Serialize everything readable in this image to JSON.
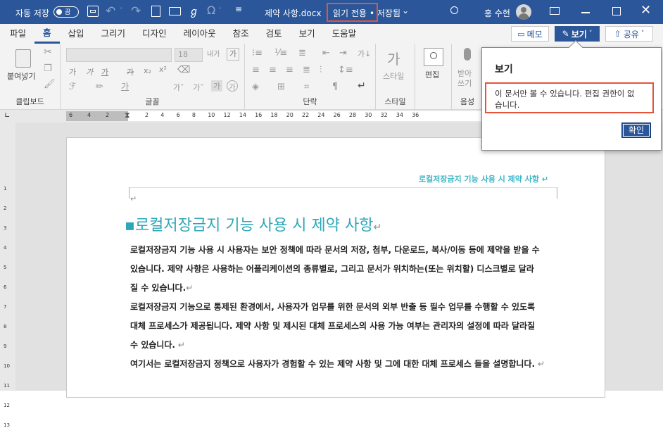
{
  "titlebar": {
    "autosave_label": "자동 저장",
    "autosave_state": "끔",
    "filename": "제약 사항.docx",
    "readonly": "읽기 전용",
    "saved": "• 저장됨",
    "user": "홍 수현"
  },
  "tabs": [
    "파일",
    "홈",
    "삽입",
    "그리기",
    "디자인",
    "레이아웃",
    "참조",
    "검토",
    "보기",
    "도움말"
  ],
  "actions": {
    "comment": "메모",
    "view": "보기",
    "share": "공유"
  },
  "ribbon": {
    "clipboard": {
      "paste": "붙여넣기",
      "label": "클립보드"
    },
    "font": {
      "size": "18",
      "gaga": "가",
      "label": "글꼴"
    },
    "paragraph": {
      "label": "단락"
    },
    "styles": {
      "button": "스타일",
      "label": "스타일"
    },
    "editing": {
      "button": "편집"
    },
    "voice": {
      "button": "받아쓰기",
      "label": "음성"
    }
  },
  "ruler": {
    "h_ticks": [
      "6",
      "4",
      "2",
      "2",
      "4",
      "6",
      "8",
      "10",
      "12",
      "14",
      "16",
      "18",
      "20",
      "22",
      "24",
      "26",
      "28",
      "30",
      "32",
      "34",
      "36"
    ],
    "v_ticks": [
      "1",
      "2",
      "3",
      "4",
      "5",
      "6",
      "7",
      "8",
      "9",
      "10",
      "11",
      "12",
      "13"
    ]
  },
  "document": {
    "header_text": "로컬저장금지 기능 사용 시 제약 사항",
    "title": "로컬저장금지 기능 사용 시 제약 사항",
    "para1": [
      "로컬저장금지 기능 사용 시 사용자는 보안 정책에 따라 문서의 저장, 첨부, 다운로드, 복사/이동 등에 제약을 받을 수",
      "있습니다. 제약 사항은 사용하는 어플리케이션의 종류별로, 그리고 문서가 위치하는(또는 위치할) 디스크별로 달라",
      "질 수 있습니다."
    ],
    "para2": [
      "로컬저장금지 기능으로 통제된 환경에서, 사용자가 업무를 위한 문서의 외부 반출 등 필수 업무를 수행할 수 있도록",
      "대체 프로세스가 제공됩니다. 제약 사항 및 제시된 대체 프로세스의 사용 가능 여부는 관리자의 설정에 따라 달라질",
      "수 있습니다."
    ],
    "para3": "여기서는 로컬저장금지 정책으로 사용자가 경험할 수 있는 제약 사항 및 그에 대한 대체 프로세스 들을 설명합니다."
  },
  "popup": {
    "title": "보기",
    "message_line1": "이 문서만 볼 수 있습니다. 편집 권한이 없",
    "message_line2": "습니다.",
    "ok": "확인"
  }
}
